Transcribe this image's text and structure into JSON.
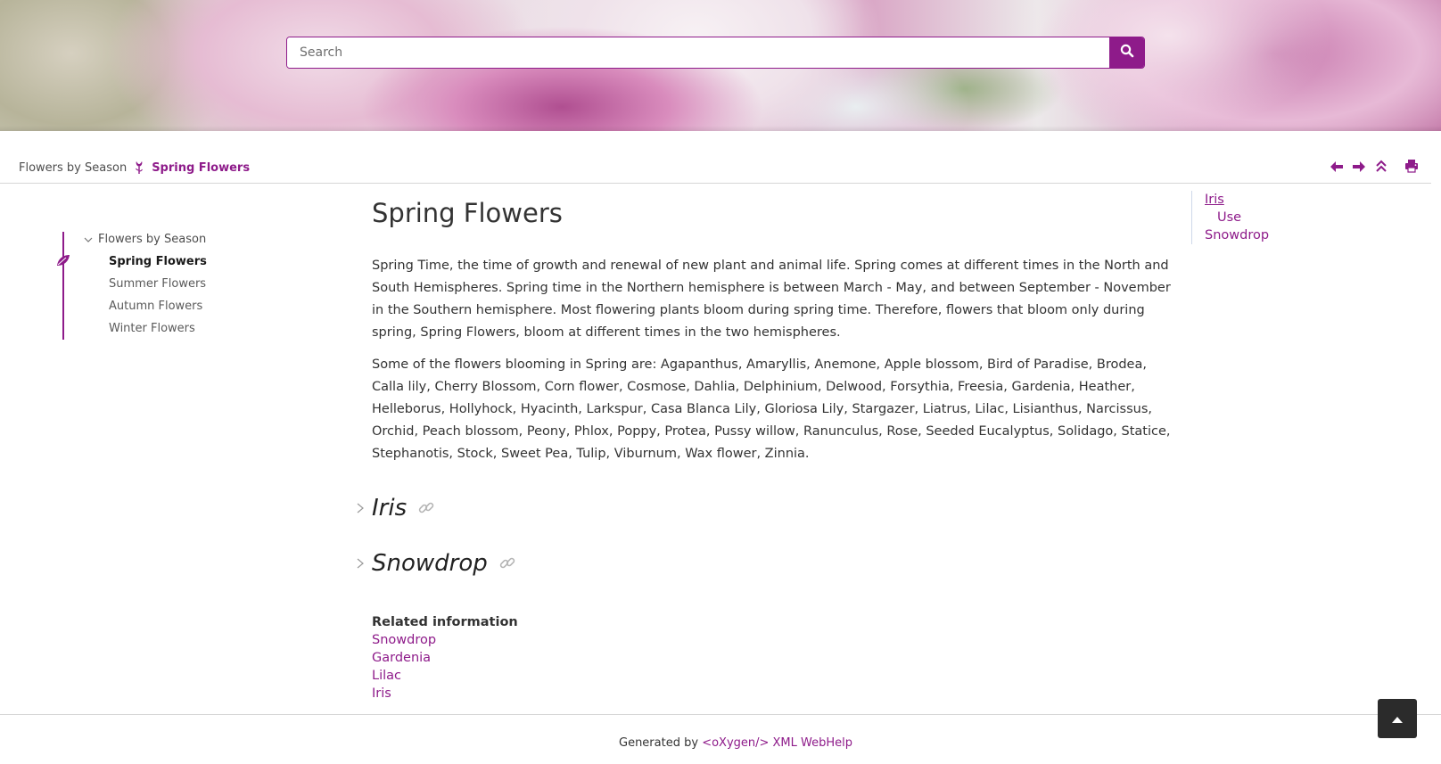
{
  "search": {
    "placeholder": "Search",
    "button_icon": "search-icon"
  },
  "breadcrumb": {
    "parent": "Flowers by Season",
    "current": "Spring Flowers"
  },
  "toolbar": {
    "icons": [
      "arrow-left-icon",
      "arrow-right-icon",
      "chevrons-up-icon",
      "print-icon"
    ],
    "accent": "#8e1b8a"
  },
  "toc": {
    "root": "Flowers by Season",
    "items": [
      "Spring Flowers",
      "Summer Flowers",
      "Autumn Flowers",
      "Winter Flowers"
    ],
    "active": "Spring Flowers"
  },
  "main": {
    "title": "Spring Flowers",
    "paragraph1": "Spring Time, the time of growth and renewal of new plant and animal life. Spring comes at different times in the North and South Hemispheres. Spring time in the Northern hemisphere is between March - May, and between September - November in the Southern hemisphere. Most flowering plants bloom during spring time. Therefore, flowers that bloom only during spring, Spring Flowers, bloom at different times in the two hemispheres.",
    "paragraph2": "Some of the flowers blooming in Spring are: Agapanthus, Amaryllis, Anemone, Apple blossom, Bird of Paradise, Brodea, Calla lily, Cherry Blossom, Corn flower, Cosmose, Dahlia, Delphinium, Delwood, Forsythia, Freesia, Gardenia, Heather, Helleborus, Hollyhock, Hyacinth, Larkspur, Casa Blanca Lily, Gloriosa Lily, Stargazer, Liatrus, Lilac, Lisianthus, Narcissus, Orchid, Peach blossom, Peony, Phlox, Poppy, Protea, Pussy willow, Ranunculus, Rose, Seeded Eucalyptus, Solidago, Statice, Stephanotis, Stock, Sweet Pea, Tulip, Viburnum, Wax flower, Zinnia.",
    "sections": [
      "Iris",
      "Snowdrop"
    ],
    "related_title": "Related information",
    "related_links": [
      "Snowdrop",
      "Gardenia",
      "Lilac",
      "Iris"
    ]
  },
  "mini_toc": {
    "items": [
      "Iris",
      "Use",
      "Snowdrop"
    ]
  },
  "footer": {
    "prefix": "Generated by ",
    "link": "<oXygen/> XML WebHelp"
  }
}
